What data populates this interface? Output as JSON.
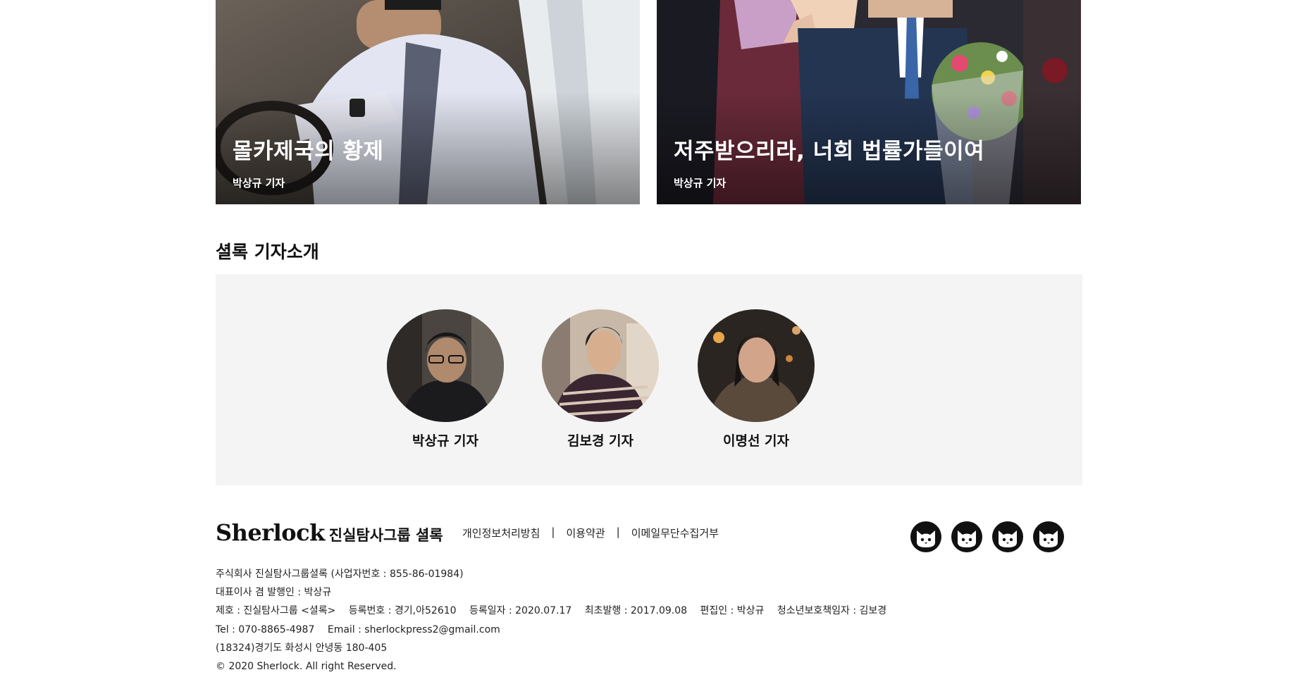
{
  "cards": [
    {
      "title": "몰카제국의 황제",
      "author": "박상규 기자"
    },
    {
      "title": "저주받으리라, 너희 법률가들이여",
      "author": "박상규 기자"
    }
  ],
  "reporters_section": {
    "title": "셜록 기자소개",
    "reporters": [
      {
        "name": "박상규 기자"
      },
      {
        "name": "김보경 기자"
      },
      {
        "name": "이명선 기자"
      }
    ]
  },
  "footer": {
    "logo_text": "Sherlock",
    "logo_sub": "진실탐사그룹 셜록",
    "links": [
      "개인정보처리방침",
      "이용약관",
      "이메일무단수집거부"
    ],
    "separator": "|",
    "social_icons": [
      "cat-icon",
      "cat-icon",
      "cat-icon",
      "cat-icon"
    ],
    "company": "주식회사 진실탐사그룹셜록 (사업자번호 : 855-86-01984)",
    "ceo": "대표이사 겸 발행인 : 박상규",
    "title_info": "제호 : 진실탐사그룹 <셜록>",
    "reg_no": "등록번호 : 경기,아52610",
    "reg_date": "등록일자 : 2020.07.17",
    "first_pub": "최초발행 : 2017.09.08",
    "editor": "편집인 : 박상규",
    "youth": "청소년보호책임자 : 김보경",
    "tel": "Tel : 070-8865-4987",
    "email": "Email : sherlockpress2@gmail.com",
    "address": "(18324)경기도 화성시 안녕동 180-405",
    "copyright": "© 2020 Sherlock. All right Reserved."
  },
  "colors": {
    "panel_bg": "#f4f4f4",
    "text": "#111111"
  }
}
